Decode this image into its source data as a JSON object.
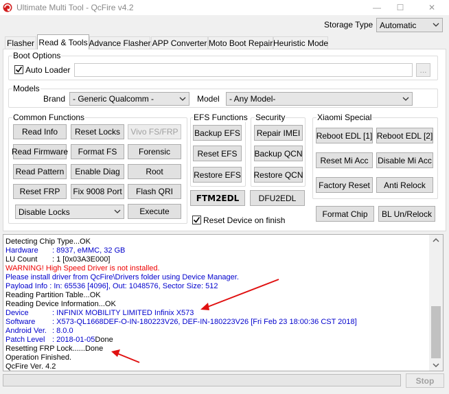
{
  "window": {
    "title": "Ultimate Multi Tool - QcFire v4.2",
    "minimize": "—",
    "maximize": "☐",
    "close": "✕"
  },
  "storage": {
    "label": "Storage Type",
    "value": "Automatic"
  },
  "tabs": [
    "Flasher",
    "Read & Tools",
    "Advance Flasher",
    "APP Converter",
    "Moto Boot Repair",
    "Heuristic Mode"
  ],
  "boot_options": {
    "title": "Boot Options",
    "auto_loader": "Auto Loader",
    "browse": "..."
  },
  "models": {
    "title": "Models",
    "brand_label": "Brand",
    "brand_value": "- Generic Qualcomm -",
    "model_label": "Model",
    "model_value": "- Any Model-"
  },
  "common": {
    "title": "Common Functions",
    "buttons": [
      "Read Info",
      "Reset Locks",
      "Vivo FS/FRP",
      "Read Firmware",
      "Format FS",
      "Forensic",
      "Read Pattern",
      "Enable Diag",
      "Root",
      "Reset FRP",
      "Fix 9008 Port",
      "Flash QRI"
    ],
    "select_value": "Disable Locks",
    "execute": "Execute"
  },
  "efs": {
    "title": "EFS Functions",
    "buttons": [
      "Backup EFS",
      "Reset EFS",
      "Restore EFS"
    ]
  },
  "security": {
    "title": "Security",
    "buttons": [
      "Repair IMEI",
      "Backup QCN",
      "Restore QCN"
    ]
  },
  "xiaomi": {
    "title": "Xiaomi Special",
    "buttons": [
      "Reboot EDL [1]",
      "Reboot EDL [2]",
      "Reset Mi Acc",
      "Disable Mi Acc",
      "Factory Reset",
      "Anti Relock"
    ]
  },
  "ftm2edl": "FTM2EDL",
  "dfu2edl": "DFU2EDL",
  "reset_device": "Reset Device on finish",
  "format_chip": "Format Chip",
  "bl_unrelock": "BL Un/Relock",
  "log": [
    {
      "text": "Detecting Chip Type...OK",
      "color": "#000000"
    },
    {
      "key": "Hardware",
      "text": ": 8937, eMMC, 32 GB",
      "color": "#0000cc"
    },
    {
      "key": "LU Count",
      "text": ": 1 [0x03A3E000]",
      "color": "#000000"
    },
    {
      "text": "WARNING! High Speed Driver is not installed.",
      "color": "#ee0000"
    },
    {
      "text": "Please install driver from QcFire\\Drivers folder using Device Manager.",
      "color": "#0000cc"
    },
    {
      "text": "Payload Info  : In: 65536 [4096], Out: 1048576, Sector Size: 512",
      "color": "#0000cc"
    },
    {
      "text": "Reading Partition Table...OK",
      "color": "#000000"
    },
    {
      "text": "Reading Device Information...OK",
      "color": "#000000"
    },
    {
      "key": "Device",
      "text": ": INFINIX MOBILITY LIMITED Infinix X573",
      "color": "#0000cc"
    },
    {
      "key": "Software",
      "text": ": X573-QL1668DEF-O-IN-180223V26, DEF-IN-180223V26 [Fri Feb 23 18:00:36 CST 2018]",
      "color": "#0000cc"
    },
    {
      "key": "Android Ver.",
      "text": ": 8.0.0",
      "color": "#0000cc"
    },
    {
      "key": "Patch Level",
      "text": ": 2018-01-05",
      "suffix": "Done",
      "color": "#0000cc"
    },
    {
      "text": "Resetting FRP Lock......Done",
      "color": "#000000"
    },
    {
      "text": "Operation Finished.",
      "color": "#000000"
    },
    {
      "text": "QcFire Ver. 4.2",
      "color": "#000000"
    }
  ],
  "stop": "Stop",
  "colors": {
    "annotation_arrow": "#e01010",
    "log_blue": "#0000cc",
    "log_red": "#ee0000"
  }
}
